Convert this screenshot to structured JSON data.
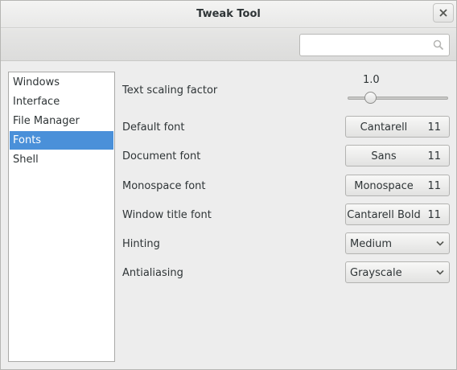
{
  "window": {
    "title": "Tweak Tool"
  },
  "search": {
    "value": "",
    "placeholder": ""
  },
  "sidebar": {
    "items": [
      {
        "label": "Windows"
      },
      {
        "label": "Interface"
      },
      {
        "label": "File Manager"
      },
      {
        "label": "Fonts",
        "selected": true
      },
      {
        "label": "Shell"
      }
    ]
  },
  "settings": {
    "text_scaling": {
      "label": "Text scaling factor",
      "value": "1.0",
      "slider_fraction": 0.1
    },
    "default_font": {
      "label": "Default font",
      "font": "Cantarell",
      "size": "11"
    },
    "document_font": {
      "label": "Document font",
      "font": "Sans",
      "size": "11"
    },
    "monospace_font": {
      "label": "Monospace font",
      "font": "Monospace",
      "size": "11"
    },
    "window_title_font": {
      "label": "Window title font",
      "font": "Cantarell Bold",
      "size": "11"
    },
    "hinting": {
      "label": "Hinting",
      "value": "Medium"
    },
    "antialiasing": {
      "label": "Antialiasing",
      "value": "Grayscale"
    }
  },
  "colors": {
    "selection": "#4a90d9",
    "window_bg": "#ededed"
  }
}
